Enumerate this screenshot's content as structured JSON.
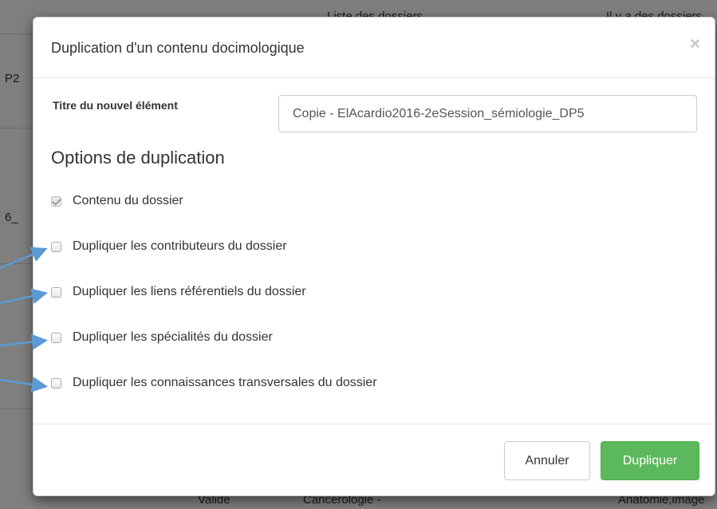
{
  "background": {
    "fragments": {
      "top_left": "Liste des dossiers",
      "top_right": "Il y a des dossiers",
      "row1": "P2",
      "row2": "6_",
      "bottom_a": "Valide",
      "bottom_b": "Cancérologie -",
      "bottom_c": "Anatomie,imagé"
    }
  },
  "modal": {
    "title": "Duplication d'un contenu docimologique",
    "close_symbol": "×",
    "field": {
      "label": "Titre du nouvel élément",
      "value": "Copie - ElAcardio2016-2eSession_sémiologie_DP5"
    },
    "section_title": "Options de duplication",
    "options": [
      {
        "label": "Contenu du dossier",
        "checked": true,
        "disabled": true
      },
      {
        "label": "Dupliquer les contributeurs du dossier",
        "checked": false
      },
      {
        "label": "Dupliquer les liens référentiels du dossier",
        "checked": false
      },
      {
        "label": "Dupliquer les spécialités du dossier",
        "checked": false
      },
      {
        "label": "Dupliquer les connaissances transversales du dossier",
        "checked": false
      }
    ],
    "buttons": {
      "cancel": "Annuler",
      "confirm": "Dupliquer"
    }
  },
  "colors": {
    "primary": "#5cb85c",
    "arrow": "#5b9bd5",
    "backdrop": "#000000"
  }
}
